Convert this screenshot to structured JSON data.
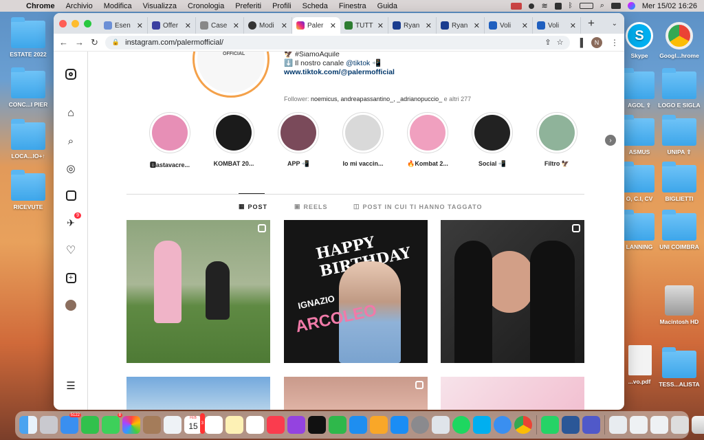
{
  "menubar": {
    "app": "Chrome",
    "items": [
      "Archivio",
      "Modifica",
      "Visualizza",
      "Cronologia",
      "Preferiti",
      "Profili",
      "Scheda",
      "Finestra",
      "Guida"
    ],
    "datetime": "Mer 15/02  16:26"
  },
  "desktop_left": [
    {
      "label": "ESTATE 2022"
    },
    {
      "label": "CONC...I PIER"
    },
    {
      "label": "LOCA...IO+↑"
    },
    {
      "label": "RICEVUTE"
    }
  ],
  "desktop_right": [
    {
      "label": "Skype"
    },
    {
      "label": "Googl...hrome"
    },
    {
      "label": "AGOL ⇪"
    },
    {
      "label": "LOGO E SIGLA"
    },
    {
      "label": "ASMUS"
    },
    {
      "label": "UNIPA ⇪"
    },
    {
      "label": "O, C.I, CV"
    },
    {
      "label": "BIGLIETTI"
    },
    {
      "label": "LANNING"
    },
    {
      "label": "UNI COIMBRA"
    },
    {
      "label": "Macintosh HD"
    },
    {
      "label": "...vo.pdf"
    },
    {
      "label": "TESS...ALISTA"
    }
  ],
  "browser": {
    "tabs": [
      {
        "label": "Esen",
        "color": "#6b8fd6"
      },
      {
        "label": "Offer",
        "color": "#3b3fa0"
      },
      {
        "label": "Case",
        "color": "#666"
      },
      {
        "label": "Modi",
        "color": "#333"
      },
      {
        "label": "Paler",
        "color": "#d6249f",
        "active": true
      },
      {
        "label": "TUTT",
        "color": "#2e7d32"
      },
      {
        "label": "Ryan",
        "color": "#1a3d8f"
      },
      {
        "label": "Ryan",
        "color": "#1a3d8f"
      },
      {
        "label": "Voli",
        "color": "#1f5fbf"
      },
      {
        "label": "Voli",
        "color": "#1f5fbf"
      }
    ],
    "url": "instagram.com/palermofficial/",
    "profile_initial": "N"
  },
  "instagram": {
    "official_text": "OFFICIAL",
    "bio_line1": "🦅 #SiamoAquile",
    "bio_line2_prefix": "⬇️ Il nostro canale ",
    "bio_line2_tag": "@tiktok",
    "bio_line2_suffix": " 📲",
    "bio_link": "www.tiktok.com/@palermofficial",
    "followers_prefix": "Follower: ",
    "followers_names": "noemicus, andreapassantino_, _adrianopuccio_",
    "followers_suffix": " e altri 277",
    "highlights": [
      {
        "label": "🅱astavacre...",
        "color": "#e78fb6"
      },
      {
        "label": "KOMBAT 20...",
        "color": "#1b1b1b"
      },
      {
        "label": "APP 📲",
        "color": "#7a4a5a"
      },
      {
        "label": "Io mi vaccin...",
        "color": "#d9d9d9"
      },
      {
        "label": "🔥Kombat 2...",
        "color": "#f0a0bf"
      },
      {
        "label": "Social 📲",
        "color": "#222"
      },
      {
        "label": "Filtro 🦅",
        "color": "#8fb39a"
      }
    ],
    "profile_tabs": [
      {
        "label": "POST",
        "icon": "grid-icon",
        "active": true
      },
      {
        "label": "REELS",
        "icon": "reels-icon"
      },
      {
        "label": "POST IN CUI TI HANNO TAGGATO",
        "icon": "tagged-icon"
      }
    ],
    "post2_text1": "HAPPY BIRTHDAY",
    "post2_text2": "IGNAZIO",
    "post2_text3": "ARCOLEO",
    "messages_badge": "9"
  },
  "dock": {
    "mail_badge": "5122",
    "messages_badge": "8",
    "calendar_day": "15",
    "calendar_month": "FEB",
    "calendar_badge": "3"
  }
}
